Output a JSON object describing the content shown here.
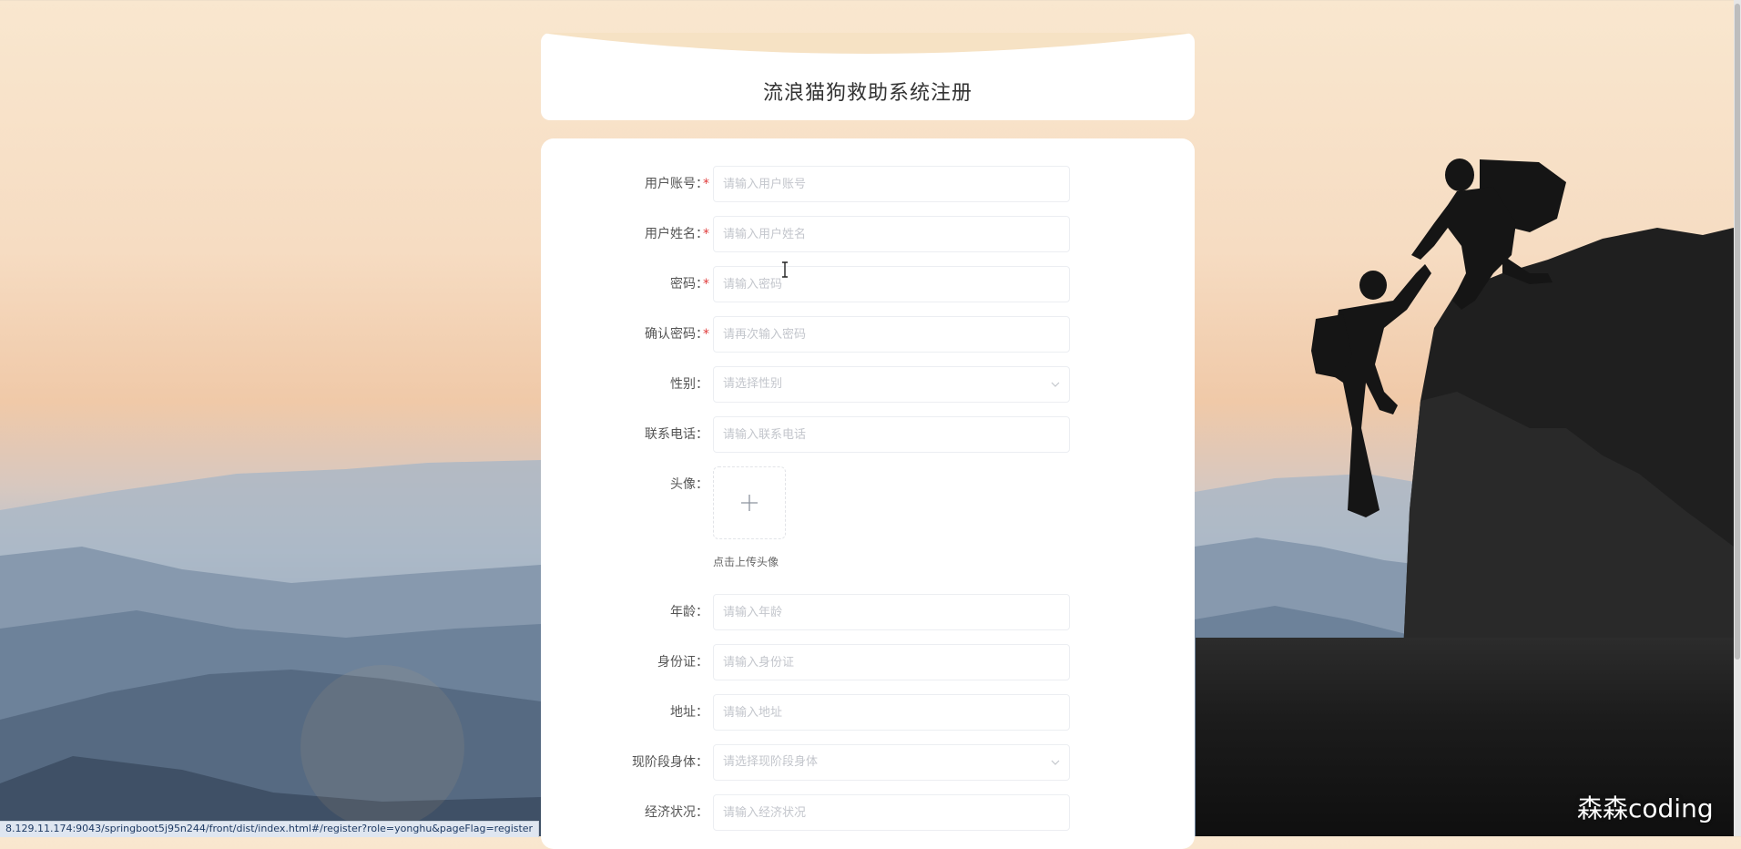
{
  "page": {
    "title": "流浪猫狗救助系统注册"
  },
  "form": {
    "fields": [
      {
        "label": "用户账号：",
        "required": true,
        "type": "input",
        "placeholder": "请输入用户账号"
      },
      {
        "label": "用户姓名：",
        "required": true,
        "type": "input",
        "placeholder": "请输入用户姓名"
      },
      {
        "label": "密码：",
        "required": true,
        "type": "password",
        "placeholder": "请输入密码"
      },
      {
        "label": "确认密码：",
        "required": true,
        "type": "password",
        "placeholder": "请再次输入密码"
      },
      {
        "label": "性别：",
        "required": false,
        "type": "select",
        "placeholder": "请选择性别"
      },
      {
        "label": "联系电话：",
        "required": false,
        "type": "input",
        "placeholder": "请输入联系电话"
      },
      {
        "label": "头像：",
        "required": false,
        "type": "upload",
        "hint": "点击上传头像"
      },
      {
        "label": "年龄：",
        "required": false,
        "type": "input",
        "placeholder": "请输入年龄"
      },
      {
        "label": "身份证：",
        "required": false,
        "type": "input",
        "placeholder": "请输入身份证"
      },
      {
        "label": "地址：",
        "required": false,
        "type": "input",
        "placeholder": "请输入地址"
      },
      {
        "label": "现阶段身体：",
        "required": false,
        "type": "select",
        "placeholder": "请选择现阶段身体"
      },
      {
        "label": "经济状况：",
        "required": false,
        "type": "input",
        "placeholder": "请输入经济状况"
      }
    ],
    "required_mark": "*"
  },
  "status_bar": {
    "url": "8.129.11.174:9043/springboot5j95n244/front/dist/index.html#/register?role=yonghu&pageFlag=register"
  },
  "watermark": {
    "text": "森森coding"
  },
  "colors": {
    "required": "#e03c3c",
    "card_bg": "#ffffff",
    "placeholder": "#c3c6cc"
  },
  "icons": {
    "upload": "plus-icon",
    "select": "chevron-down-icon",
    "cursor": "text-cursor-icon"
  }
}
